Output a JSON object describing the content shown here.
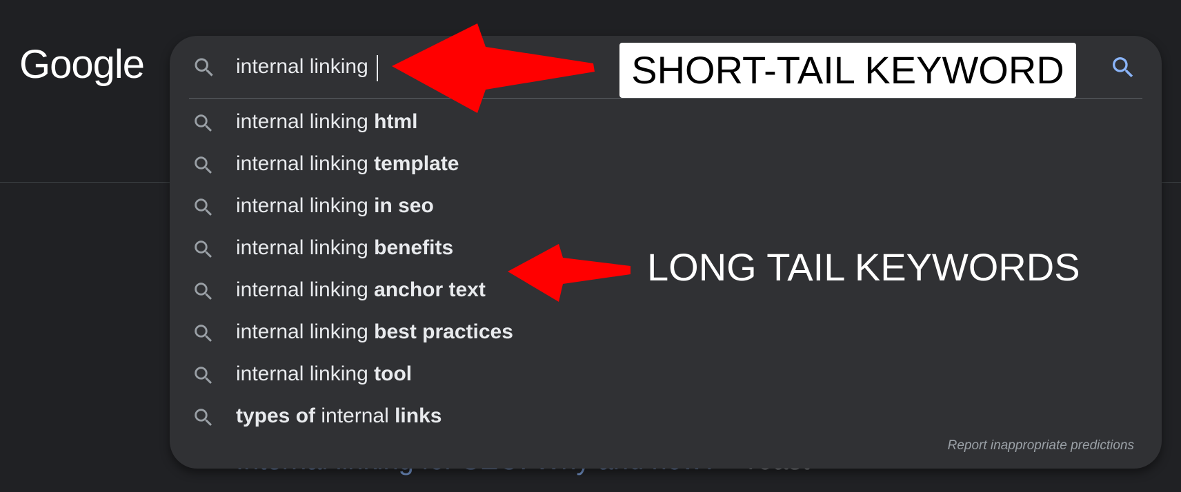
{
  "logo": "Google",
  "search": {
    "query": "internal linking",
    "suggestions": [
      {
        "parts": [
          {
            "t": "internal linking ",
            "b": false
          },
          {
            "t": "html",
            "b": true
          }
        ]
      },
      {
        "parts": [
          {
            "t": "internal linking ",
            "b": false
          },
          {
            "t": "template",
            "b": true
          }
        ]
      },
      {
        "parts": [
          {
            "t": "internal linking ",
            "b": false
          },
          {
            "t": "in seo",
            "b": true
          }
        ]
      },
      {
        "parts": [
          {
            "t": "internal linking ",
            "b": false
          },
          {
            "t": "benefits",
            "b": true
          }
        ]
      },
      {
        "parts": [
          {
            "t": "internal linking ",
            "b": false
          },
          {
            "t": "anchor text",
            "b": true
          }
        ]
      },
      {
        "parts": [
          {
            "t": "internal linking ",
            "b": false
          },
          {
            "t": "best practices",
            "b": true
          }
        ]
      },
      {
        "parts": [
          {
            "t": "internal linking ",
            "b": false
          },
          {
            "t": "tool",
            "b": true
          }
        ]
      },
      {
        "parts": [
          {
            "t": "types of ",
            "b": true
          },
          {
            "t": "internal ",
            "b": false
          },
          {
            "t": "links",
            "b": true
          }
        ]
      }
    ],
    "report_link": "Report inappropriate predictions"
  },
  "annotations": {
    "short_tail": "SHORT-TAIL KEYWORD",
    "long_tail": "LONG TAIL KEYWORDS",
    "arrow_color": "#ff0000"
  },
  "background_result": {
    "link_part": "Internal linking for SEO: Why and how?",
    "rest": " - Yoast"
  },
  "icons": {
    "search": "search-icon",
    "submit": "search-submit-icon"
  },
  "colors": {
    "page_bg": "#202124",
    "panel_bg": "#303134",
    "text": "#e8eaed",
    "icon": "#9aa0a6",
    "submit_icon": "#8ab4f8"
  }
}
